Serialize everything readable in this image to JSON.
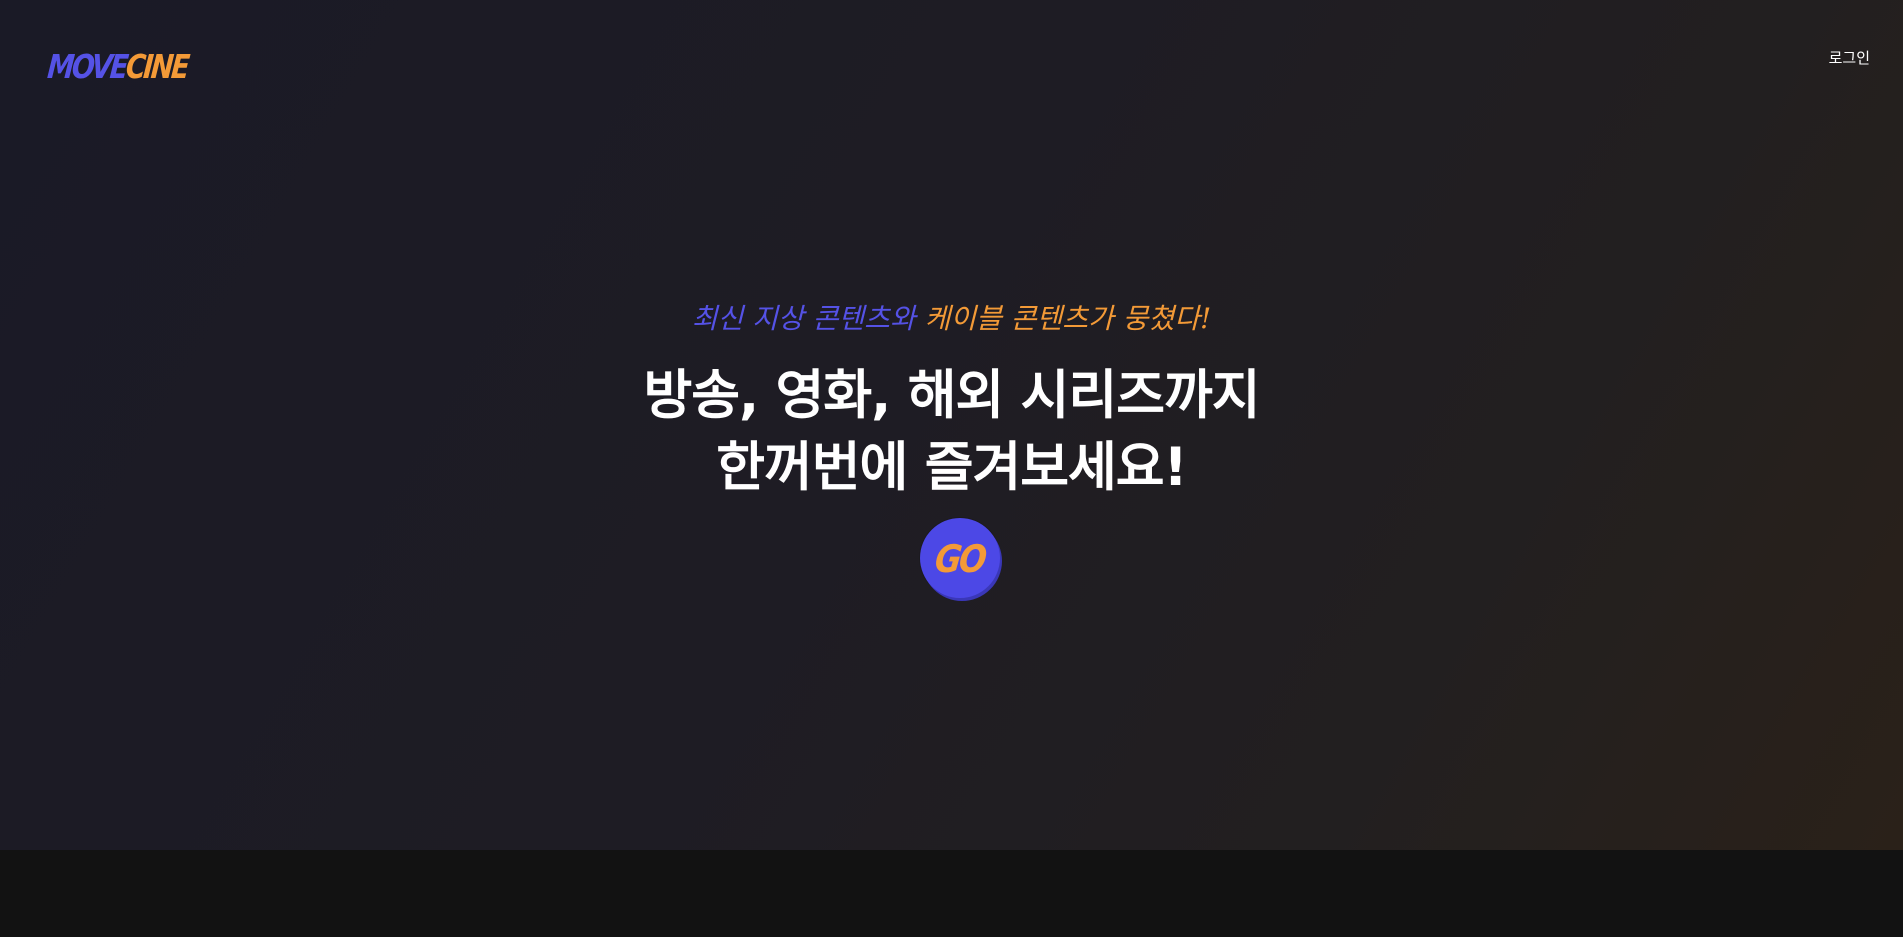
{
  "header": {
    "logo_part1": "MOVE",
    "logo_part2": "CINE",
    "login_label": "로그인"
  },
  "hero": {
    "tagline_part1": "최신 지상 콘텐츠와 ",
    "tagline_part2": "케이블 콘텐츠가 뭉쳤다!",
    "headline_line1": "방송, 영화, 해외 시리즈까지",
    "headline_line2": "한꺼번에 즐겨보세요!",
    "go_label": "GO"
  },
  "colors": {
    "brand_primary": "#5552e6",
    "brand_accent": "#f39a37",
    "background": "#1e1c24",
    "footer_background": "#121212",
    "text": "#ffffff"
  }
}
